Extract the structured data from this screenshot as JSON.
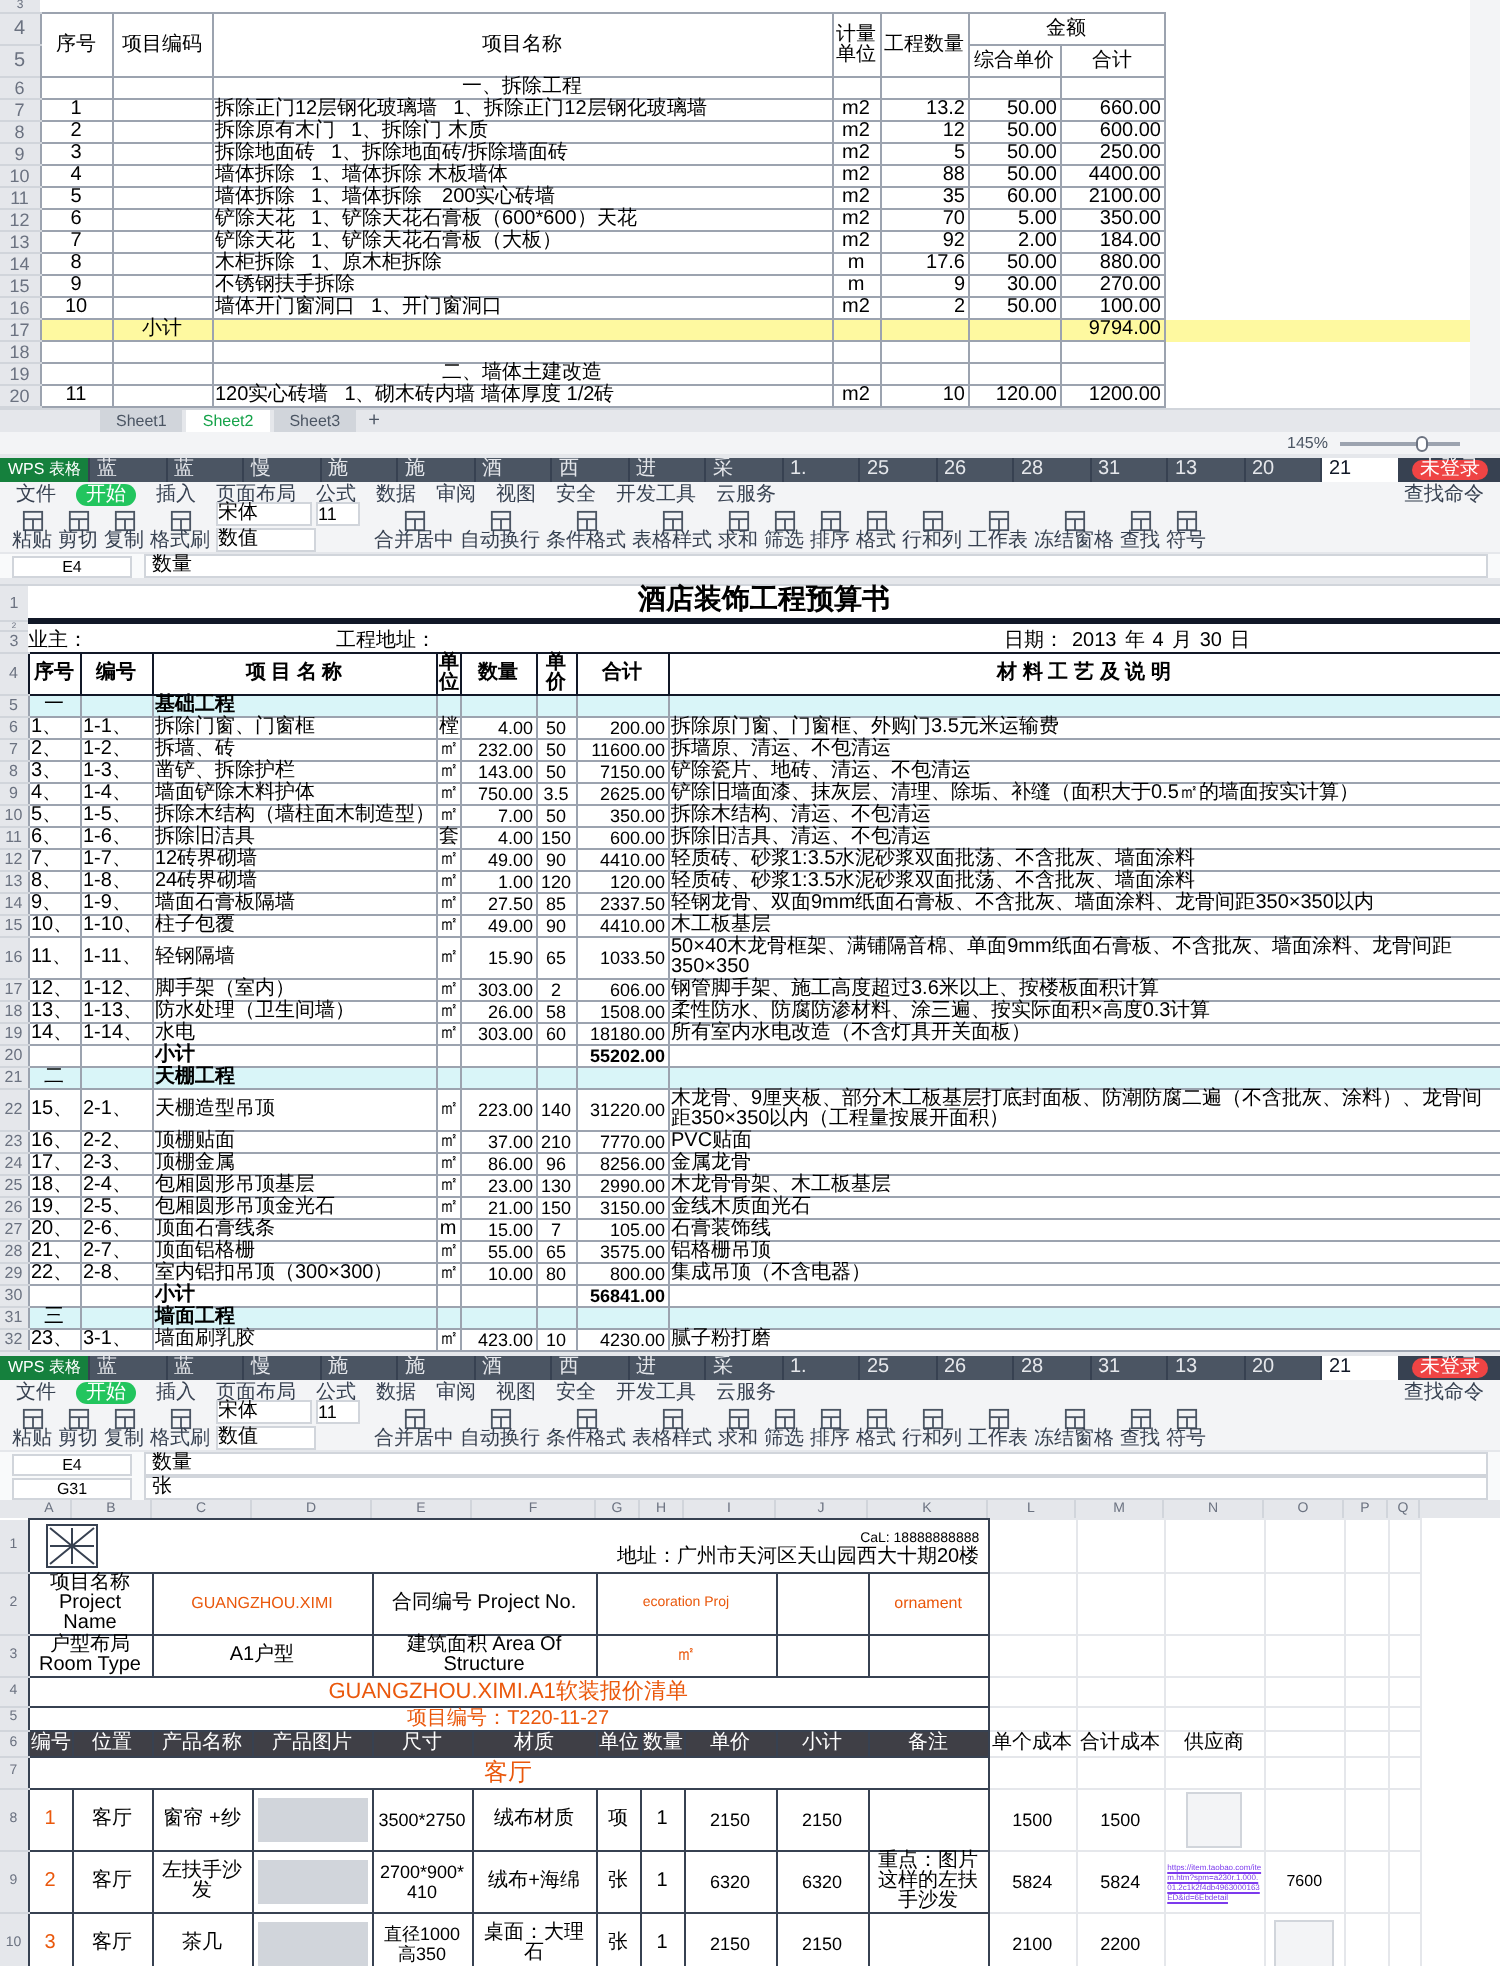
{
  "sheet_top": {
    "blank_rows": [
      "3"
    ],
    "header": {
      "rows": [
        "4",
        "5"
      ],
      "no": "序号",
      "code": "项目编码",
      "name": "项目名称",
      "unit": "计量单位",
      "qty": "工程数量",
      "amount": "金额",
      "unit_price": "综合单价",
      "total": "合计"
    },
    "rows": [
      {
        "row": "6",
        "kind": "section",
        "text": "一、拆除工程"
      },
      {
        "row": "7",
        "kind": "item",
        "no": "1",
        "name": "拆除正门12层钢化玻璃墙",
        "detail": "1、拆除正门12层钢化玻璃墙",
        "unit": "m2",
        "qty": "13.2",
        "price": "50.00",
        "total": "660.00"
      },
      {
        "row": "8",
        "kind": "item",
        "no": "2",
        "name": "拆除原有木门",
        "detail": "1、拆除门 木质",
        "unit": "m2",
        "qty": "12",
        "price": "50.00",
        "total": "600.00"
      },
      {
        "row": "9",
        "kind": "item",
        "no": "3",
        "name": "拆除地面砖",
        "detail": "1、拆除地面砖/拆除墙面砖",
        "unit": "m2",
        "qty": "5",
        "price": "50.00",
        "total": "250.00"
      },
      {
        "row": "10",
        "kind": "item",
        "no": "4",
        "name": "墙体拆除",
        "detail": "1、墙体拆除 木板墙体",
        "unit": "m2",
        "qty": "88",
        "price": "50.00",
        "total": "4400.00"
      },
      {
        "row": "11",
        "kind": "item",
        "no": "5",
        "name": "墙体拆除",
        "detail": "1、墙体拆除　200实心砖墙",
        "unit": "m2",
        "qty": "35",
        "price": "60.00",
        "total": "2100.00"
      },
      {
        "row": "12",
        "kind": "item",
        "no": "6",
        "name": "铲除天花",
        "detail": "1、铲除天花石膏板（600*600）天花",
        "unit": "m2",
        "qty": "70",
        "price": "5.00",
        "total": "350.00"
      },
      {
        "row": "13",
        "kind": "item",
        "no": "7",
        "name": "铲除天花",
        "detail": "1、铲除天花石膏板（大板）",
        "unit": "m2",
        "qty": "92",
        "price": "2.00",
        "total": "184.00"
      },
      {
        "row": "14",
        "kind": "item",
        "no": "8",
        "name": "木柜拆除",
        "detail": "1、原木柜拆除",
        "unit": "m",
        "qty": "17.6",
        "price": "50.00",
        "total": "880.00"
      },
      {
        "row": "15",
        "kind": "item",
        "no": "9",
        "name": "不锈钢扶手拆除",
        "unit": "m",
        "qty": "9",
        "price": "30.00",
        "total": "270.00"
      },
      {
        "row": "16",
        "kind": "item",
        "no": "10",
        "name": "墙体开门窗洞口",
        "detail": "1、开门窗洞口",
        "unit": "m2",
        "qty": "2",
        "price": "50.00",
        "total": "100.00"
      },
      {
        "row": "17",
        "kind": "subtotal",
        "label": "小计",
        "total": "9794.00"
      },
      {
        "row": "18",
        "kind": "blank"
      },
      {
        "row": "19",
        "kind": "section",
        "text": "二、墙体土建改造"
      },
      {
        "row": "20",
        "kind": "item",
        "no": "11",
        "name": "120实心砖墙",
        "detail": "1、砌木砖内墙 墙体厚度 1/2砖",
        "unit": "m2",
        "qty": "10",
        "price": "120.00",
        "total": "1200.00"
      }
    ],
    "sheet_tabs": [
      {
        "label": "Sheet1",
        "selected": false
      },
      {
        "label": "Sheet2",
        "selected": true
      },
      {
        "label": "Sheet3",
        "selected": false
      }
    ],
    "add_tab": "+",
    "zoom": "145%",
    "zoom_slider": {
      "level": 0.7
    }
  },
  "window_middle": {
    "app_tab": "WPS 表格",
    "doc_tabs": [
      {
        "label": "蓝",
        "selected": false
      },
      {
        "label": "蓝",
        "selected": false
      },
      {
        "label": "慢",
        "selected": false
      },
      {
        "label": "施",
        "selected": false
      },
      {
        "label": "施",
        "selected": false
      },
      {
        "label": "酒",
        "selected": false
      },
      {
        "label": "西",
        "selected": false
      },
      {
        "label": "进",
        "selected": false
      },
      {
        "label": "采",
        "selected": false
      },
      {
        "label": "1.",
        "selected": false
      },
      {
        "label": "25",
        "selected": false
      },
      {
        "label": "26",
        "selected": false
      },
      {
        "label": "28",
        "selected": false
      },
      {
        "label": "31",
        "selected": false
      },
      {
        "label": "13",
        "selected": false
      },
      {
        "label": "20",
        "selected": false
      },
      {
        "label": "21",
        "selected": true
      }
    ],
    "login_badge": "未登录",
    "menu": [
      {
        "label": "文件",
        "selected": false
      },
      {
        "label": "开始",
        "selected": true
      },
      {
        "label": "插入",
        "selected": false
      },
      {
        "label": "页面布局",
        "selected": false
      },
      {
        "label": "公式",
        "selected": false
      },
      {
        "label": "数据",
        "selected": false
      },
      {
        "label": "审阅",
        "selected": false
      },
      {
        "label": "视图",
        "selected": false
      },
      {
        "label": "安全",
        "selected": false
      },
      {
        "label": "开发工具",
        "selected": false
      },
      {
        "label": "云服务",
        "selected": false
      }
    ],
    "search": "查找命令",
    "font": "宋体",
    "font_size": "11",
    "number_format": "数值",
    "ribbon": [
      "粘贴",
      "剪切",
      "复制",
      "格式刷",
      "合并居中",
      "自动换行",
      "条件格式",
      "表格样式",
      "求和",
      "筛选",
      "排序",
      "格式",
      "行和列",
      "工作表",
      "冻结窗格",
      "查找",
      "符号"
    ],
    "name_box": "E4",
    "formula": "数量",
    "sheet": {
      "row_numbers": [
        "1",
        "2",
        "3",
        "4"
      ],
      "title": "酒店装饰工程预算书",
      "info": {
        "owner": "业主：",
        "address": "工程地址：",
        "date_label": "日期：",
        "year": "2013",
        "year_unit": "年",
        "month": "4",
        "month_unit": "月",
        "day": "30",
        "day_unit": "日"
      },
      "header": [
        "序号",
        "编号",
        "项 目 名 称",
        "单位",
        "数量",
        "单价",
        "合计",
        "材 料 工 艺 及 说 明"
      ],
      "rows": [
        {
          "row": "5",
          "kind": "section",
          "no": "一",
          "name": "基础工程"
        },
        {
          "row": "6",
          "kind": "item",
          "no": "1、",
          "code": "1-1、",
          "name": "拆除门窗、门窗框",
          "unit": "樘",
          "qty": "4.00",
          "price": "50",
          "total": "200.00",
          "note": "拆除原门窗、门窗框、外购门3.5元米运输费"
        },
        {
          "row": "7",
          "kind": "item",
          "no": "2、",
          "code": "1-2、",
          "name": "拆墙、砖",
          "unit": "㎡",
          "qty": "232.00",
          "price": "50",
          "total": "11600.00",
          "note": "拆墙原、清运、不包清运"
        },
        {
          "row": "8",
          "kind": "item",
          "no": "3、",
          "code": "1-3、",
          "name": "凿铲、拆除护栏",
          "unit": "㎡",
          "qty": "143.00",
          "price": "50",
          "total": "7150.00",
          "note": "铲除瓷片、地砖、清运、不包清运"
        },
        {
          "row": "9",
          "kind": "item",
          "no": "4、",
          "code": "1-4、",
          "name": "墙面铲除木料护体",
          "unit": "㎡",
          "qty": "750.00",
          "price": "3.5",
          "total": "2625.00",
          "note": "铲除旧墙面漆、抹灰层、清理、除垢、补缝（面积大于0.5㎡的墙面按实计算）"
        },
        {
          "row": "10",
          "kind": "item",
          "no": "5、",
          "code": "1-5、",
          "name": "拆除木结构（墙柱面木制造型）",
          "unit": "㎡",
          "qty": "7.00",
          "price": "50",
          "total": "350.00",
          "note": "拆除木结构、清运、不包清运"
        },
        {
          "row": "11",
          "kind": "item",
          "no": "6、",
          "code": "1-6、",
          "name": "拆除旧洁具",
          "unit": "套",
          "qty": "4.00",
          "price": "150",
          "total": "600.00",
          "note": "拆除旧洁具、清运、不包清运"
        },
        {
          "row": "12",
          "kind": "item",
          "no": "7、",
          "code": "1-7、",
          "name": "12砖界砌墙",
          "unit": "㎡",
          "qty": "49.00",
          "price": "90",
          "total": "4410.00",
          "note": "轻质砖、砂浆1:3.5水泥砂浆双面批荡、不含批灰、墙面涂料"
        },
        {
          "row": "13",
          "kind": "item",
          "no": "8、",
          "code": "1-8、",
          "name": "24砖界砌墙",
          "unit": "㎡",
          "qty": "1.00",
          "price": "120",
          "total": "120.00",
          "note": "轻质砖、砂浆1:3.5水泥砂浆双面批荡、不含批灰、墙面涂料"
        },
        {
          "row": "14",
          "kind": "item",
          "no": "9、",
          "code": "1-9、",
          "name": "墙面石膏板隔墙",
          "unit": "㎡",
          "qty": "27.50",
          "price": "85",
          "total": "2337.50",
          "note": "轻钢龙骨、双面9mm纸面石膏板、不含批灰、墙面涂料、龙骨间距350×350以内"
        },
        {
          "row": "15",
          "kind": "item",
          "no": "10、",
          "code": "1-10、",
          "name": "柱子包覆",
          "unit": "㎡",
          "qty": "49.00",
          "price": "90",
          "total": "4410.00",
          "note": "木工板基层"
        },
        {
          "row": "16",
          "kind": "item",
          "no": "11、",
          "code": "1-11、",
          "name": "轻钢隔墙",
          "unit": "㎡",
          "qty": "15.90",
          "price": "65",
          "total": "1033.50",
          "note": "50×40木龙骨框架、满铺隔音棉、单面9mm纸面石膏板、不含批灰、墙面涂料、龙骨间距350×350"
        },
        {
          "row": "17",
          "kind": "item",
          "no": "12、",
          "code": "1-12、",
          "name": "脚手架（室内）",
          "unit": "㎡",
          "qty": "303.00",
          "price": "2",
          "total": "606.00",
          "note": "钢管脚手架、施工高度超过3.6米以上、按楼板面积计算"
        },
        {
          "row": "18",
          "kind": "item",
          "no": "13、",
          "code": "1-13、",
          "name": "防水处理（卫生间墙）",
          "unit": "㎡",
          "qty": "26.00",
          "price": "58",
          "total": "1508.00",
          "note": "柔性防水、防腐防渗材料、涂三遍、按实际面积×高度0.3计算"
        },
        {
          "row": "19",
          "kind": "item",
          "no": "14、",
          "code": "1-14、",
          "name": "水电",
          "unit": "㎡",
          "qty": "303.00",
          "price": "60",
          "total": "18180.00",
          "note": "所有室内水电改造（不含灯具开关面板）"
        },
        {
          "row": "20",
          "kind": "subtotal",
          "name": "小计",
          "total": "55202.00"
        },
        {
          "row": "21",
          "kind": "section",
          "no": "二",
          "name": "天棚工程"
        },
        {
          "row": "22",
          "kind": "item",
          "no": "15、",
          "code": "2-1、",
          "name": "天棚造型吊顶",
          "unit": "㎡",
          "qty": "223.00",
          "price": "140",
          "total": "31220.00",
          "note": "木龙骨、9厘夹板、部分木工板基层打底封面板、防潮防腐二遍（不含批灰、涂料）、龙骨间距350×350以内（工程量按展开面积）"
        },
        {
          "row": "23",
          "kind": "item",
          "no": "16、",
          "code": "2-2、",
          "name": "顶棚贴面",
          "unit": "㎡",
          "qty": "37.00",
          "price": "210",
          "total": "7770.00",
          "note": "PVC贴面"
        },
        {
          "row": "24",
          "kind": "item",
          "no": "17、",
          "code": "2-3、",
          "name": "顶棚金属",
          "unit": "㎡",
          "qty": "86.00",
          "price": "96",
          "total": "8256.00",
          "note": "金属龙骨"
        },
        {
          "row": "25",
          "kind": "item",
          "no": "18、",
          "code": "2-4、",
          "name": "包厢圆形吊顶基层",
          "unit": "㎡",
          "qty": "23.00",
          "price": "130",
          "total": "2990.00",
          "note": "木龙骨骨架、木工板基层"
        },
        {
          "row": "26",
          "kind": "item",
          "no": "19、",
          "code": "2-5、",
          "name": "包厢圆形吊顶金光石",
          "unit": "㎡",
          "qty": "21.00",
          "price": "150",
          "total": "3150.00",
          "note": "金线木质面光石"
        },
        {
          "row": "27",
          "kind": "item",
          "no": "20、",
          "code": "2-6、",
          "name": "顶面石膏线条",
          "unit": "m",
          "qty": "15.00",
          "price": "7",
          "total": "105.00",
          "note": "石膏装饰线"
        },
        {
          "row": "28",
          "kind": "item",
          "no": "21、",
          "code": "2-7、",
          "name": "顶面铝格栅",
          "unit": "㎡",
          "qty": "55.00",
          "price": "65",
          "total": "3575.00",
          "note": "铝格栅吊顶"
        },
        {
          "row": "29",
          "kind": "item",
          "no": "22、",
          "code": "2-8、",
          "name": "室内铝扣吊顶（300×300）",
          "unit": "㎡",
          "qty": "10.00",
          "price": "80",
          "total": "800.00",
          "note": "集成吊顶（不含电器）"
        },
        {
          "row": "30",
          "kind": "subtotal",
          "name": "小计",
          "total": "56841.00"
        },
        {
          "row": "31",
          "kind": "section",
          "no": "三",
          "name": "墙面工程"
        },
        {
          "row": "32",
          "kind": "item",
          "no": "23、",
          "code": "3-1、",
          "name": "墙面刷乳胶",
          "unit": "㎡",
          "qty": "423.00",
          "price": "10",
          "total": "4230.00",
          "note": "腻子粉打磨"
        }
      ]
    }
  },
  "window_bottom": {
    "app_tab": "WPS 表格",
    "doc_tabs": [
      {
        "label": "蓝",
        "selected": false
      },
      {
        "label": "蓝",
        "selected": false
      },
      {
        "label": "慢",
        "selected": false
      },
      {
        "label": "施",
        "selected": false
      },
      {
        "label": "施",
        "selected": false
      },
      {
        "label": "酒",
        "selected": false
      },
      {
        "label": "西",
        "selected": false
      },
      {
        "label": "进",
        "selected": false
      },
      {
        "label": "采",
        "selected": false
      },
      {
        "label": "1.",
        "selected": false
      },
      {
        "label": "25",
        "selected": false
      },
      {
        "label": "26",
        "selected": false
      },
      {
        "label": "28",
        "selected": false
      },
      {
        "label": "31",
        "selected": false
      },
      {
        "label": "13",
        "selected": false
      },
      {
        "label": "20",
        "selected": false
      },
      {
        "label": "21",
        "selected": true
      }
    ],
    "login_badge": "未登录",
    "menu": [
      {
        "label": "文件",
        "selected": false
      },
      {
        "label": "开始",
        "selected": true
      },
      {
        "label": "插入",
        "selected": false
      },
      {
        "label": "页面布局",
        "selected": false
      },
      {
        "label": "公式",
        "selected": false
      },
      {
        "label": "数据",
        "selected": false
      },
      {
        "label": "审阅",
        "selected": false
      },
      {
        "label": "视图",
        "selected": false
      },
      {
        "label": "安全",
        "selected": false
      },
      {
        "label": "开发工具",
        "selected": false
      },
      {
        "label": "云服务",
        "selected": false
      }
    ],
    "search": "查找命令",
    "font": "宋体",
    "font_size": "11",
    "number_format": "数值",
    "ribbon": [
      "粘贴",
      "剪切",
      "复制",
      "格式刷",
      "合并居中",
      "自动换行",
      "条件格式",
      "表格样式",
      "求和",
      "筛选",
      "排序",
      "格式",
      "行和列",
      "工作表",
      "冻结窗格",
      "查找",
      "符号"
    ],
    "name_box": "E4",
    "formula": "数量",
    "name_box_2": "G31",
    "formula_2": "张",
    "columns": [
      "A",
      "B",
      "C",
      "D",
      "E",
      "F",
      "G",
      "H",
      "I",
      "J",
      "K",
      "L",
      "M",
      "N",
      "O",
      "P",
      "Q"
    ],
    "sheet": {
      "row_numbers": [
        "1",
        "2",
        "3",
        "4",
        "5",
        "6",
        "7"
      ],
      "contact": "CaL: 18888888888",
      "address": "地址：广州市天河区天山园西大十期20楼",
      "project_label": "项目名称 Project Name",
      "project": "GUANGZHOU.XIMI",
      "contract_label": "合同编号 Project No.",
      "contract": "ecoration Proj",
      "contract_extra": "ornament",
      "room_label": "户型布局 Room Type",
      "room": "A1户型",
      "area_label": "建筑面积 Area Of Structure",
      "area": "㎡",
      "title": "GUANGZHOU.XIMI.A1软装报价清单",
      "code": "项目编号：T220-11-27",
      "header": [
        "编号",
        "位置",
        "产品名称",
        "产品图片",
        "尺寸",
        "材质",
        "单位",
        "数量",
        "单价",
        "小计",
        "备注"
      ],
      "extra_header": [
        "单个成本",
        "合计成本",
        "供应商"
      ],
      "section": "客厅",
      "rows": [
        {
          "row": "8",
          "kind": "screenshot",
          "no": "1",
          "place": "客厅",
          "product": "窗帘 +纱",
          "size": "3500*2750",
          "material": "绒布材质",
          "unit": "项",
          "qty": "1",
          "price": "2150",
          "subtotal": "2150",
          "cost": "1500",
          "total_cost": "1500"
        },
        {
          "row": "9",
          "kind": "link",
          "no": "2",
          "place": "客厅",
          "product": "左扶手沙发",
          "size": "2700*900*410",
          "material": "绒布+海绵",
          "unit": "张",
          "qty": "1",
          "price": "6320",
          "subtotal": "6320",
          "remark": "重点：图片这样的左扶手沙发",
          "cost": "5824",
          "total_cost": "5824",
          "supplier": "https://item.taobao.com/item.htm?spm=a230r.1.000.01.2c1k2f4db4963000163ED&id=6Ebdetail",
          "extra": "7600"
        },
        {
          "row": "10",
          "kind": "photo",
          "no": "3",
          "place": "客厅",
          "product": "茶几",
          "size": "直径1000高350",
          "material": "桌面：大理石",
          "unit": "张",
          "qty": "1",
          "price": "2150",
          "subtotal": "2150",
          "cost": "2100",
          "total_cost": "2200"
        }
      ]
    }
  }
}
